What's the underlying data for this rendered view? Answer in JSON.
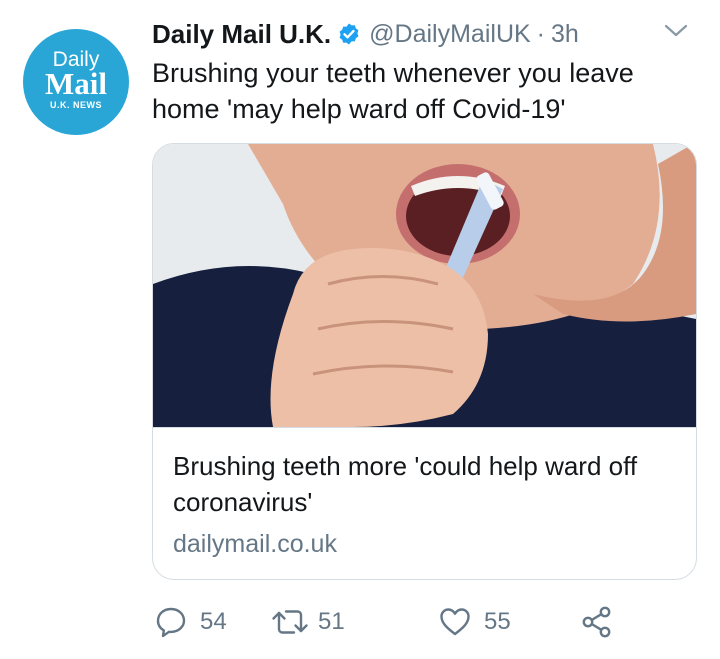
{
  "account": {
    "display_name": "Daily Mail U.K.",
    "handle": "@DailyMailUK",
    "separator": "·",
    "time": "3h",
    "avatar_text_top": "Daily",
    "avatar_text_main": "Mail",
    "avatar_text_sub": "U.K. NEWS"
  },
  "tweet": {
    "text": "Brushing your teeth whenever you leave home 'may help ward off Covid-19'"
  },
  "card": {
    "title": "Brushing teeth more 'could help ward off coronavirus'",
    "domain": "dailymail.co.uk"
  },
  "actions": {
    "reply_count": "54",
    "retweet_count": "51",
    "like_count": "55"
  },
  "colors": {
    "avatar_bg": "#2aa6d6",
    "verified_blue": "#1da1f2",
    "secondary_text": "#657786",
    "card_border": "#d5dde3",
    "shirt_navy": "#16203e"
  },
  "icons": {
    "verified": "verified-badge-icon",
    "caret": "chevron-down-icon",
    "reply": "reply-icon",
    "retweet": "retweet-icon",
    "like": "heart-icon",
    "share": "share-icon"
  }
}
